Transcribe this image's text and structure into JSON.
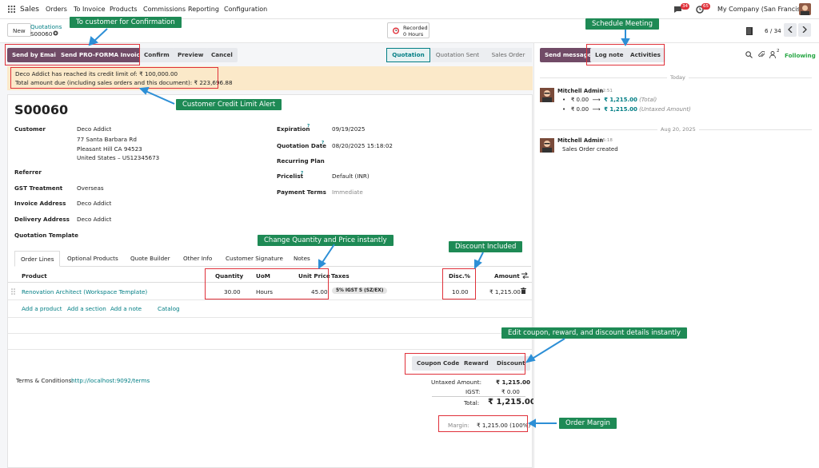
{
  "topbar": {
    "app": "Sales",
    "menu": [
      "Orders",
      "To Invoice",
      "Products",
      "Commissions",
      "Reporting",
      "Configuration"
    ],
    "msg_badge": "34",
    "activity_badge": "65",
    "company": "My Company (San Francisco)"
  },
  "breadcrumb": {
    "new_label": "New",
    "parent": "Quotations",
    "current": "S00060"
  },
  "timer": {
    "label": "Recorded",
    "value": "0 Hours"
  },
  "pager": {
    "value": "6 / 34"
  },
  "actions": {
    "send_email": "Send by Email",
    "send_proforma": "Send PRO-FORMA Invoice",
    "confirm": "Confirm",
    "preview": "Preview",
    "cancel": "Cancel"
  },
  "statusbar": [
    "Quotation",
    "Quotation Sent",
    "Sales Order"
  ],
  "alert": {
    "line1": "Deco Addict has reached its credit limit of: ₹ 100,000.00",
    "line2": "Total amount due (including sales orders and this document): ₹ 223,696.88"
  },
  "order": {
    "name": "S00060",
    "customer_label": "Customer",
    "customer_name": "Deco Addict",
    "address1": "77 Santa Barbara Rd",
    "address2": "Pleasant Hill CA 94523",
    "address3": "United States – US12345673",
    "referrer_label": "Referrer",
    "gst_label": "GST Treatment",
    "gst_value": "Overseas",
    "invoice_label": "Invoice Address",
    "invoice_value": "Deco Addict",
    "delivery_label": "Delivery Address",
    "delivery_value": "Deco Addict",
    "template_label": "Quotation Template",
    "expiration_label": "Expiration",
    "expiration_value": "09/19/2025",
    "qdate_label": "Quotation Date",
    "qdate_value": "08/20/2025 15:18:02",
    "recurring_label": "Recurring Plan",
    "pricelist_label": "Pricelist",
    "pricelist_value": "Default (INR)",
    "terms_label": "Payment Terms",
    "terms_value": "Immediate"
  },
  "tabs": [
    "Order Lines",
    "Optional Products",
    "Quote Builder",
    "Other Info",
    "Customer Signature",
    "Notes"
  ],
  "table": {
    "headers": {
      "product": "Product",
      "qty": "Quantity",
      "uom": "UoM",
      "price": "Unit Price",
      "taxes": "Taxes",
      "disc": "Disc.%",
      "amount": "Amount"
    },
    "row": {
      "product": "Renovation Architect (Workspace Template)",
      "qty": "30.00",
      "uom": "Hours",
      "price": "45.00",
      "tax": "5% IGST S (SZ/EX)",
      "disc": "10.00",
      "amount": "₹ 1,215.00"
    },
    "add_product": "Add a product",
    "add_section": "Add a section",
    "add_note": "Add a note",
    "catalog": "Catalog"
  },
  "reward_buttons": {
    "coupon": "Coupon Code",
    "reward": "Reward",
    "discount": "Discount"
  },
  "terms": {
    "label": "Terms & Conditions:",
    "link": "http://localhost:9092/terms"
  },
  "totals": {
    "untaxed_label": "Untaxed Amount:",
    "untaxed_value": "₹ 1,215.00",
    "igst_label": "IGST:",
    "igst_value": "₹ 0.00",
    "total_label": "Total:",
    "total_value": "₹ 1,215.00",
    "margin_label": "Margin:",
    "margin_value": "₹ 1,215.00 (100%)"
  },
  "chatter": {
    "send_message": "Send message",
    "log_note": "Log note",
    "activities": "Activities",
    "followers_count": "2",
    "following": "Following",
    "today": "Today",
    "msg1_author": "Mitchell Admin",
    "msg1_time": "12:51",
    "msg1_line1_old": "₹ 0.00",
    "msg1_line1_new": "₹ 1,215.00",
    "msg1_line1_field": "(Total)",
    "msg1_line2_old": "₹ 0.00",
    "msg1_line2_new": "₹ 1,215.00",
    "msg1_line2_field": "(Untaxed Amount)",
    "date2": "Aug 20, 2025",
    "msg2_author": "Mitchell Admin",
    "msg2_time": "15:18",
    "msg2_text": "Sales Order created"
  },
  "callouts": {
    "confirmation": "To customer for Confirmation",
    "schedule": "Schedule Meeting",
    "credit": "Customer Credit Limit Alert",
    "qty_price": "Change Quantity and Price instantly",
    "discount": "Discount Included",
    "coupon": "Edit coupon, reward, and discount details instantly",
    "margin": "Order Margin"
  },
  "colors": {
    "brand": "#714b67",
    "accent": "#017e84",
    "callout": "#1e8a55",
    "highlight_box": "#e0313a",
    "arrow": "#2d8fd6",
    "alert_bg": "#fbe9c9"
  }
}
